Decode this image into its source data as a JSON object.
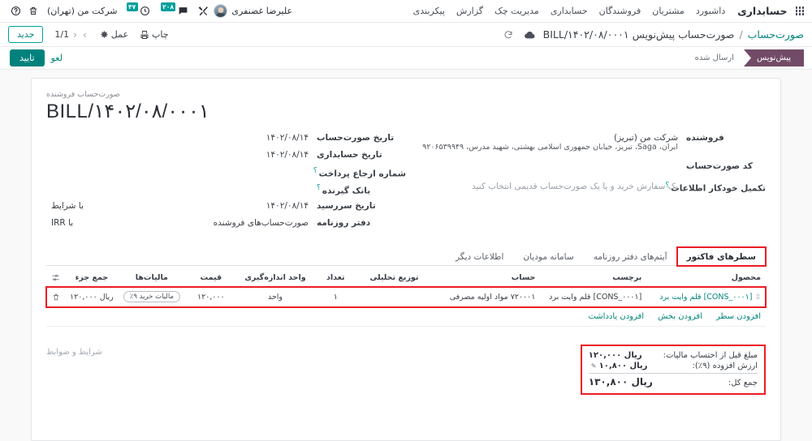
{
  "navbar": {
    "brand": "حسابداری",
    "menu": [
      "داشبورد",
      "مشتریان",
      "فروشندگان",
      "حسابداری",
      "مدیریت چک",
      "گزارش",
      "پیکربندی"
    ],
    "activities_badge": "۴۷",
    "messages_badge": "۲۰۸",
    "company": "شرکت من (تهران)",
    "user": "علیرضا غضنفری",
    "icons": {
      "apps": "apps-grid-icon",
      "clock": "activities-clock-icon",
      "chat": "messages-chat-icon",
      "trash": "trash-icon",
      "help": "help-icon",
      "tools": "developer-tools-icon",
      "avatar": "user-avatar"
    }
  },
  "controlbar": {
    "breadcrumb_root": "صورت‌حساب",
    "breadcrumb_sep": "/",
    "breadcrumb_current": "صورت‌حساب پیش‌نویس BILL/۱۴۰۲/۰۸/۰۰۰۱",
    "print_label": "چاپ",
    "action_label": "عمل",
    "pager": "1/1",
    "new_label": "جدید"
  },
  "statusbar": {
    "confirm_label": "تایید",
    "cancel_label": "لغو",
    "stages": [
      {
        "label": "پیش‌نویس",
        "active": true
      },
      {
        "label": "ارسال شده",
        "active": false
      }
    ]
  },
  "form": {
    "doc_label": "صورت‌حساب فروشنده",
    "doc_number": "BILL/۱۴۰۲/۰۸/۰۰۰۱",
    "right_column": [
      {
        "label": "فروشنده",
        "value": "شرکت من (تبریز)",
        "second": "ایران، Saga، تبریز، خیابان جمهوری اسلامی بهشتی، شهید مدرس، ۹۲۰۶۵۳۹۹۴۹"
      },
      {
        "label": "کد صورت‌حساب",
        "value": ""
      },
      {
        "label": "تکمیل خودکار اطلاعات",
        "help": "؟",
        "value": "یک سفارش خرید و یا یک صورت‌حساب قدیمی انتخاب کنید",
        "placeholder": true
      }
    ],
    "left_column": [
      {
        "label": "تاریخ صورت‌حساب",
        "value": "۱۴۰۲/۰۸/۱۴"
      },
      {
        "label": "تاریخ حسابداری",
        "value": "۱۴۰۲/۰۸/۱۴"
      },
      {
        "label": "شماره ارجاع پرداخت",
        "help": "؟",
        "value": ""
      },
      {
        "label": "بانک گیرنده",
        "help": "؟",
        "value": ""
      },
      {
        "label": "تاریخ سررسید",
        "value": "۱۴۰۲/۰۸/۱۴"
      },
      {
        "label": "دفتر روزنامه",
        "value": "صورت‌حساب‌های فروشنده"
      }
    ],
    "far_left_column": [
      {
        "label": "شرایط",
        "prefix": "با"
      },
      {
        "label": "واحد",
        "prefix": "با",
        "value": "IRR"
      }
    ]
  },
  "tabs": [
    {
      "label": "سطرهای فاکتور",
      "active": true
    },
    {
      "label": "آیتم‌های دفتر روزنامه",
      "active": false
    },
    {
      "label": "سامانه مودیان",
      "active": false
    },
    {
      "label": "اطلاعات دیگر",
      "active": false
    }
  ],
  "table": {
    "headers": [
      "محصول",
      "برچسب",
      "حساب",
      "توزیع تحلیلی",
      "تعداد",
      "واحد اندازه‌گیری",
      "قیمت",
      "مالیات‌ها",
      "جمع جزء"
    ],
    "rows": [
      {
        "product": "[CONS_۰۰۰۱] قلم وایت برد",
        "label": "[CONS_۰۰۰۱] قلم وایت برد",
        "account": "۷۲۰۰۰۱ مواد اولیه مصرفی",
        "analytic": "",
        "quantity": "۱",
        "uom": "واحد",
        "price": "۱۲۰,۰۰۰",
        "taxes": "مالیات خرید ۹٪",
        "subtotal": "ریال ۱۲۰,۰۰۰"
      }
    ],
    "add_links": [
      "افزودن سطر",
      "افزودن بخش",
      "افزودن یادداشت"
    ],
    "optional_cols_icon": "column-settings-icon",
    "delete_icon": "trash-icon",
    "drag_icon": "drag-handle-icon"
  },
  "footer": {
    "terms_placeholder": "شرایط و ضوابط",
    "totals": [
      {
        "label": "مبلغ قبل از احتساب مالیات:",
        "value": "ریال ۱۲۰,۰۰۰",
        "sum": false,
        "pen": false
      },
      {
        "label": "ارزش افزوده (۹٪):",
        "value": "ریال ۱۰,۸۰۰",
        "sum": false,
        "pen": true
      },
      {
        "label": "جمع کل:",
        "value": "ریال ۱۳۰,۸۰۰",
        "sum": true,
        "pen": false
      }
    ]
  },
  "colors": {
    "accent": "#00857a",
    "brand_purple": "#714b67",
    "badge_teal": "#00a09d",
    "highlight_red": "#ec1c24"
  }
}
